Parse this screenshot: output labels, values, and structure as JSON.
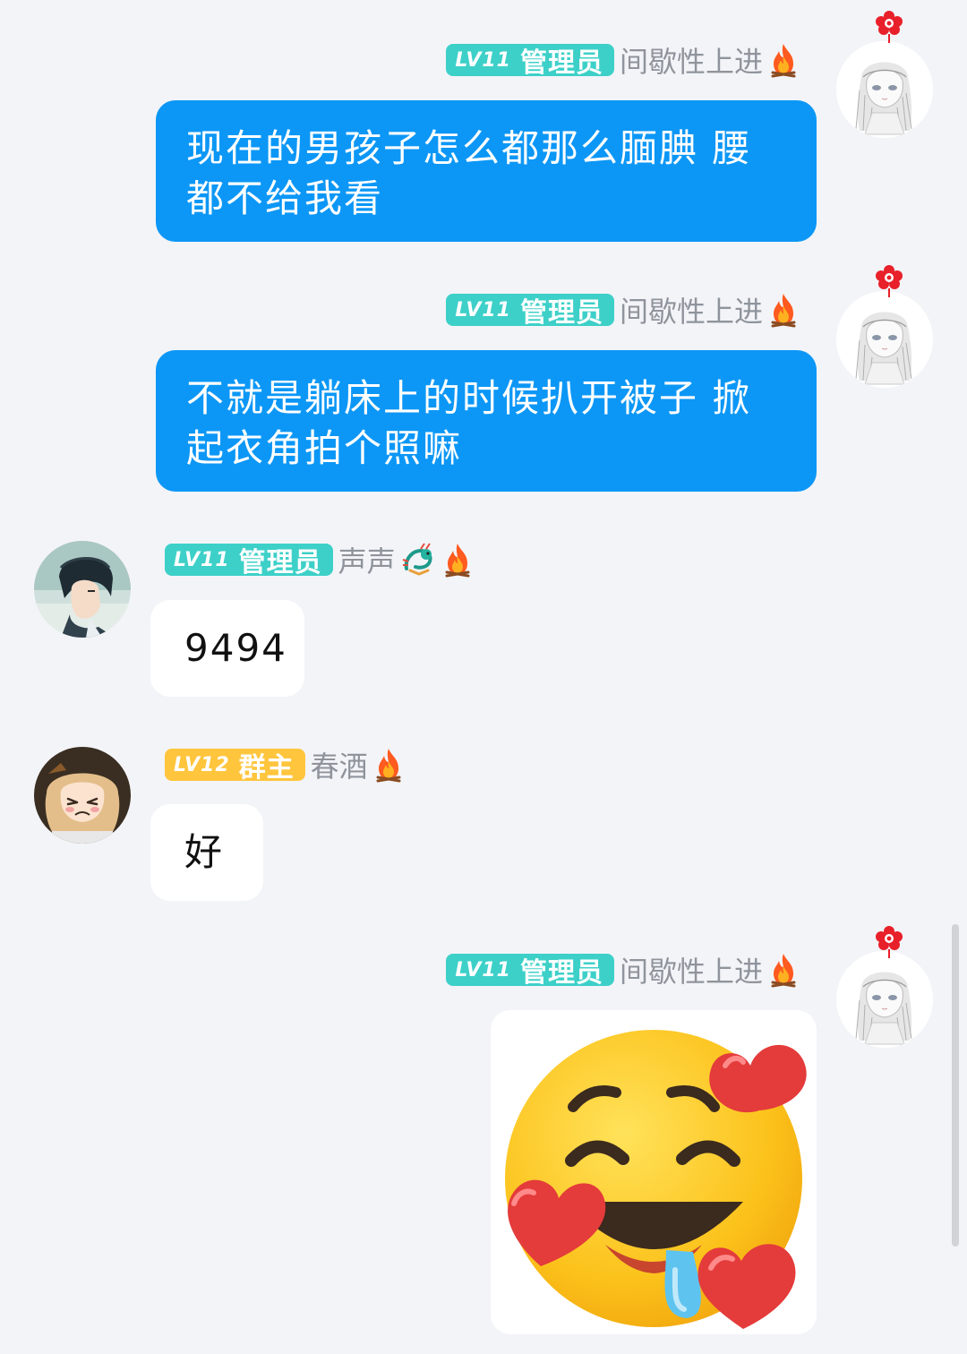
{
  "messages": [
    {
      "side": "right",
      "level": "LV11",
      "role": "管理员",
      "nickname": "间歇性上进",
      "text": "现在的男孩子怎么都那么腼腆  腰都不给我看"
    },
    {
      "side": "right",
      "level": "LV11",
      "role": "管理员",
      "nickname": "间歇性上进",
      "text": "不就是躺床上的时候扒开被子  掀起衣角拍个照嘛"
    },
    {
      "side": "left",
      "level": "LV11",
      "role": "管理员",
      "nickname": "声声",
      "text": "9494"
    },
    {
      "side": "left",
      "level": "LV12",
      "role": "群主",
      "nickname": "春酒",
      "text": "好"
    },
    {
      "side": "right",
      "level": "LV11",
      "role": "管理员",
      "nickname": "间歇性上进",
      "sticker": "smiling-face-with-hearts-drooling-sticker"
    }
  ],
  "colors": {
    "background": "#f3f4f8",
    "own_bubble": "#0c97f6",
    "other_bubble": "#ffffff",
    "admin_badge": "#3dd0c8",
    "owner_badge": "#ffc53d",
    "nickname": "#8f949c"
  },
  "icons": {
    "fire": "fire-icon",
    "dragon": "dragon-icon"
  }
}
